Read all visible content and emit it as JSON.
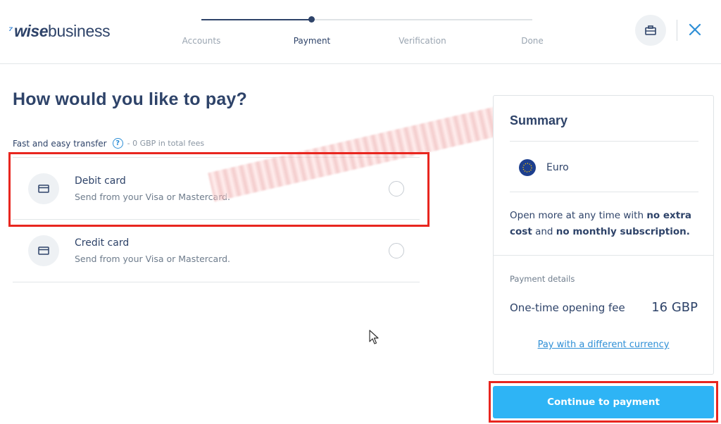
{
  "brand": {
    "wise": "wise",
    "business": "business"
  },
  "stepper": {
    "steps": [
      {
        "label": "Accounts"
      },
      {
        "label": "Payment"
      },
      {
        "label": "Verification"
      },
      {
        "label": "Done"
      }
    ],
    "active_step": "Payment"
  },
  "header": {
    "business_icon": "briefcase-icon",
    "close_icon": "close-icon"
  },
  "main": {
    "title": "How would you like to pay?",
    "section": {
      "label": "Fast and easy transfer",
      "help_icon": "?",
      "fees": "- 0 GBP in total fees"
    },
    "options": [
      {
        "title": "Debit card",
        "subtitle": "Send from your Visa or Mastercard.",
        "icon": "card-icon"
      },
      {
        "title": "Credit card",
        "subtitle": "Send from your Visa or Mastercard.",
        "icon": "card-icon"
      }
    ]
  },
  "summary": {
    "title": "Summary",
    "currency": "Euro",
    "info": {
      "part1": "Open more at any time with ",
      "bold1": "no extra cost",
      "part2": " and ",
      "bold2": "no monthly subscription."
    },
    "payment_details_label": "Payment details",
    "fee_label": "One-time opening fee",
    "fee_value": "16 GBP",
    "link": "Pay with a different currency"
  },
  "continue_button": "Continue to payment",
  "colors": {
    "accent": "#2eb4f5",
    "navy": "#2e4369",
    "link": "#2e8fd6",
    "highlight": "#e8261f"
  }
}
